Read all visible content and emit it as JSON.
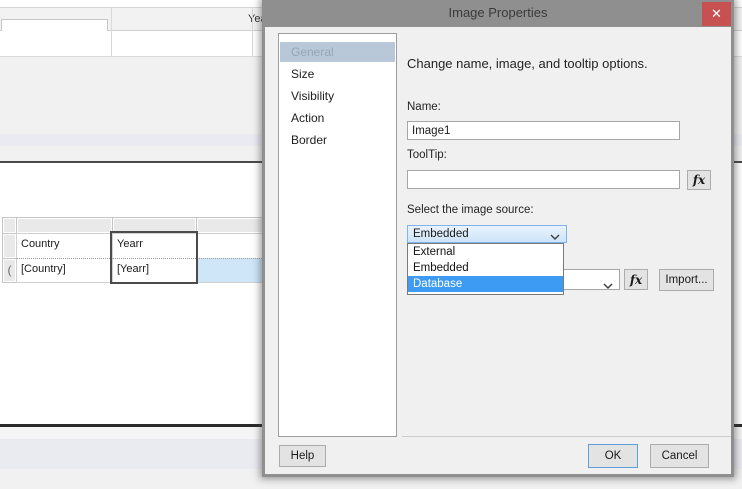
{
  "background": {
    "toolbar_dropdown_value": "",
    "clipped_header_label": "Year",
    "table": {
      "header_row": {
        "col1": "Country",
        "col2": "Yearr"
      },
      "data_row": {
        "col1": "[Country]",
        "col2": "[Yearr]"
      },
      "detail_marker": "("
    }
  },
  "dialog": {
    "title": "Image Properties",
    "close_glyph": "✕",
    "tabs": [
      {
        "label": "General"
      },
      {
        "label": "Size"
      },
      {
        "label": "Visibility"
      },
      {
        "label": "Action"
      },
      {
        "label": "Border"
      }
    ],
    "selected_tab": "General",
    "description": "Change name, image, and tooltip options.",
    "name": {
      "label": "Name:",
      "value": "Image1"
    },
    "tooltip": {
      "label": "ToolTip:",
      "value": ""
    },
    "image_source": {
      "label": "Select the image source:",
      "selected": "Embedded",
      "options": [
        "External",
        "Embedded",
        "Database"
      ],
      "highlighted_option": "Database"
    },
    "fx_glyph": "fx",
    "buttons": {
      "import": "Import...",
      "help": "Help",
      "ok": "OK",
      "cancel": "Cancel"
    },
    "colors": {
      "titlebar": "#8f8f8f",
      "close_red": "#c75050",
      "selection_blue": "#3d9bf3",
      "combo_focus_border": "#7eb4ea",
      "highlight_cell_blue": "#cfe5f8",
      "tab_selected_bg": "#b9c8d9"
    }
  }
}
